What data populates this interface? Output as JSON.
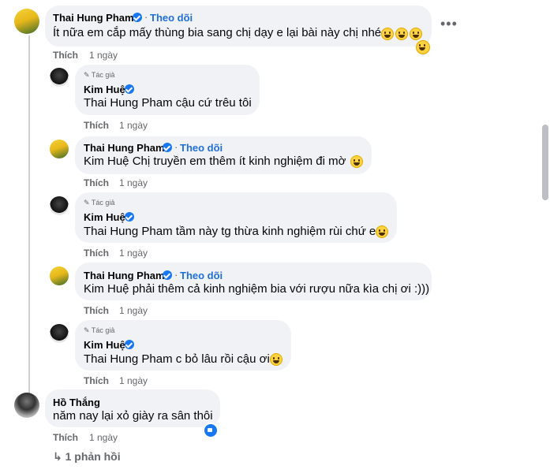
{
  "comments": [
    {
      "name": "Thai Hung Pham",
      "follow": "Theo dõi",
      "text": "Ít nữa em cắp mấy thùng bia sang chị dạy e lại bài này chị nhé",
      "like": "Thích",
      "time": "1 ngày"
    },
    {
      "badge": "Tác giả",
      "name": "Kim Huệ",
      "mention": "Thai Hung Pham",
      "text": " cậu cứ trêu tôi",
      "like": "Thích",
      "time": "1 ngày"
    },
    {
      "name": "Thai Hung Pham",
      "follow": "Theo dõi",
      "mention": "Kim Huệ",
      "text": " Chị truyền em thêm ít kinh nghiệm đi mờ",
      "like": "Thích",
      "time": "1 ngày"
    },
    {
      "badge": "Tác giả",
      "name": "Kim Huệ",
      "mention": "Thai Hung Pham",
      "text": " tầm này tg thừa kinh nghiệm rùi chứ e",
      "like": "Thích",
      "time": "1 ngày"
    },
    {
      "name": "Thai Hung Pham",
      "follow": "Theo dõi",
      "mention": "Kim Huệ",
      "text": " phải thêm cả kinh nghiệm bia với rượu nữa kìa chị ơi :)))",
      "like": "Thích",
      "time": "1 ngày"
    },
    {
      "badge": "Tác giả",
      "name": "Kim Huệ",
      "mention": "Thai Hung Pham",
      "text": " c bỏ lâu rồi cậu ơi",
      "like": "Thích",
      "time": "1 ngày"
    },
    {
      "name": "Hồ Thắng",
      "text": "năm nay lại xỏ giày ra sân thôi",
      "like": "Thích",
      "time": "1 ngày"
    }
  ],
  "replies_link": "1 phản hồi",
  "icons": {
    "more": "more-options-icon",
    "verified": "verified-badge-icon",
    "author": "pencil-icon",
    "reply": "reply-arrow-icon",
    "like": "like-reaction-icon",
    "emoji": "grinning-emoji-icon"
  },
  "colors": {
    "link": "#216fdb",
    "bubble": "#f0f2f5",
    "verified": "#1877f2"
  }
}
